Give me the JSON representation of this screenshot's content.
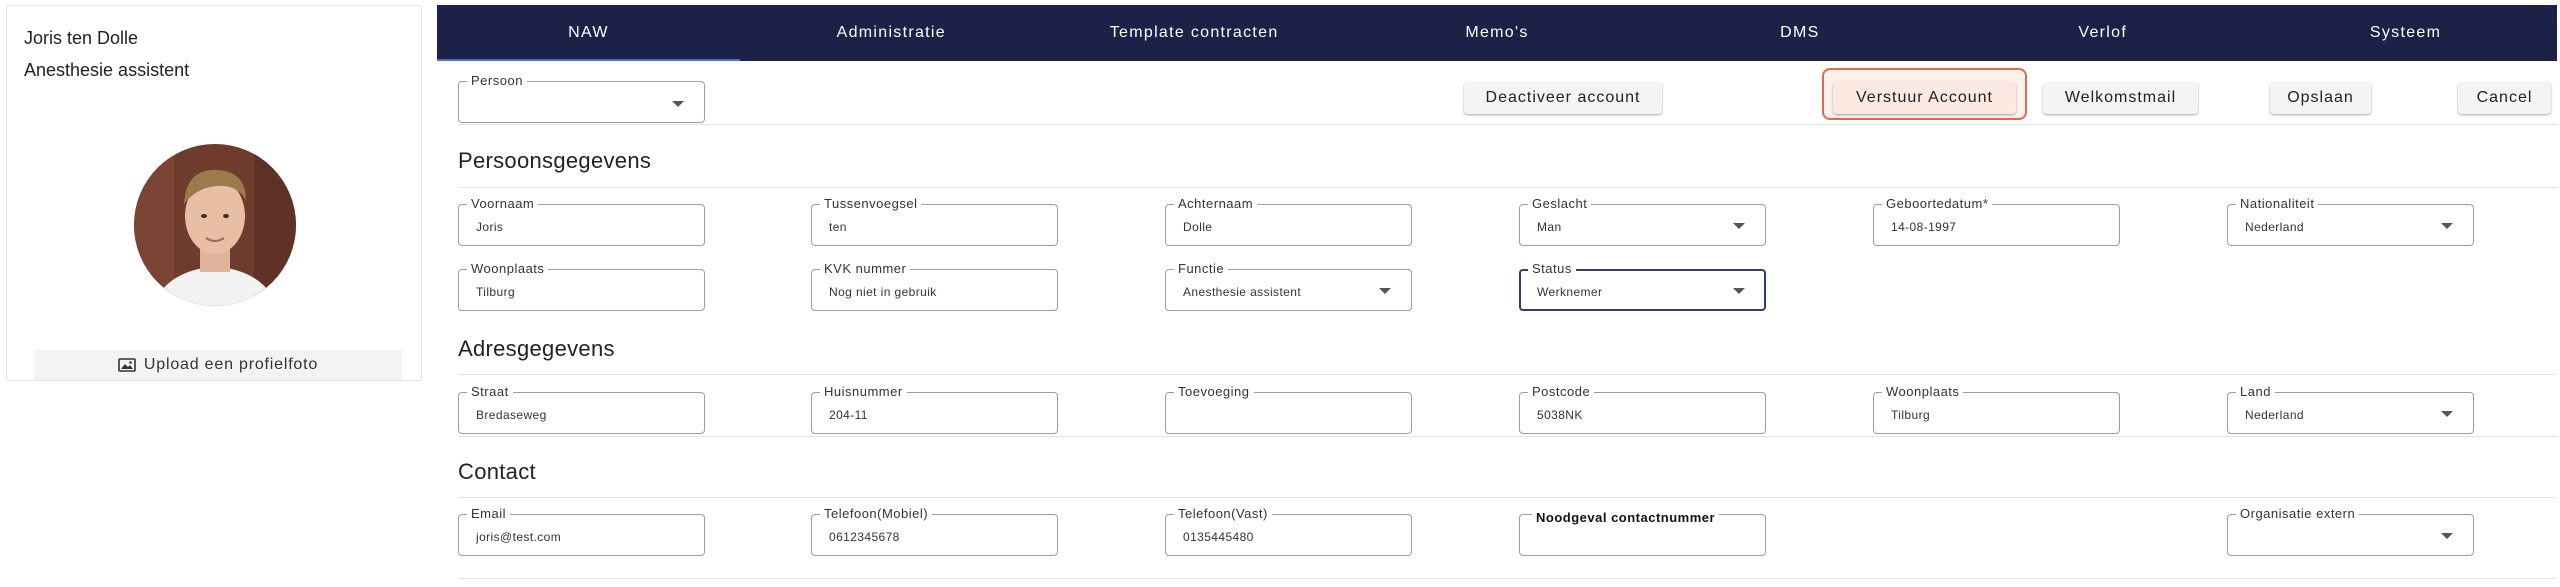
{
  "profile": {
    "name": "Joris ten Dolle",
    "role": "Anesthesie assistent",
    "upload_label": "Upload een profielfoto"
  },
  "tabs": [
    {
      "label": "NAW",
      "active": true
    },
    {
      "label": "Administratie"
    },
    {
      "label": "Template contracten"
    },
    {
      "label": "Memo's"
    },
    {
      "label": "DMS"
    },
    {
      "label": "Verlof"
    },
    {
      "label": "Systeem"
    }
  ],
  "toolbar": {
    "persoon_label": "Persoon",
    "persoon_value": "",
    "deactivate_label": "Deactiveer account",
    "send_account_label": "Verstuur Account",
    "welcome_mail_label": "Welkomstmail",
    "save_label": "Opslaan",
    "cancel_label": "Cancel"
  },
  "sections": {
    "personal": {
      "title": "Persoonsgegevens",
      "voornaam": {
        "label": "Voornaam",
        "value": "Joris"
      },
      "tussenvoegsel": {
        "label": "Tussenvoegsel",
        "value": "ten"
      },
      "achternaam": {
        "label": "Achternaam",
        "value": "Dolle"
      },
      "geslacht": {
        "label": "Geslacht",
        "value": "Man"
      },
      "geboortedatum": {
        "label": "Geboortedatum*",
        "value": "14-08-1997"
      },
      "nationaliteit": {
        "label": "Nationaliteit",
        "value": "Nederland"
      },
      "woonplaats": {
        "label": "Woonplaats",
        "value": "Tilburg"
      },
      "kvk": {
        "label": "KVK nummer",
        "value": "Nog niet in gebruik"
      },
      "functie": {
        "label": "Functie",
        "value": "Anesthesie assistent"
      },
      "status": {
        "label": "Status",
        "value": "Werknemer"
      }
    },
    "address": {
      "title": "Adresgegevens",
      "straat": {
        "label": "Straat",
        "value": "Bredaseweg"
      },
      "huisnummer": {
        "label": "Huisnummer",
        "value": "204-11"
      },
      "toevoeging": {
        "label": "Toevoeging",
        "value": ""
      },
      "postcode": {
        "label": "Postcode",
        "value": "5038NK"
      },
      "woonplaats": {
        "label": "Woonplaats",
        "value": "Tilburg"
      },
      "land": {
        "label": "Land",
        "value": "Nederland"
      }
    },
    "contact": {
      "title": "Contact",
      "email": {
        "label": "Email",
        "value": "joris@test.com"
      },
      "mobiel": {
        "label": "Telefoon(Mobiel)",
        "value": "0612345678"
      },
      "vast": {
        "label": "Telefoon(Vast)",
        "value": "0135445480"
      },
      "noodgeval": {
        "label": "Noodgeval contactnummer",
        "value": ""
      },
      "organisatie": {
        "label": "Organisatie extern",
        "value": ""
      }
    }
  },
  "colors": {
    "tabs_bg": "#1c2147",
    "active_tab_underline": "#4f6bd6",
    "highlight_ring": "#df6a4e",
    "focused_field_border": "#2f3b7a"
  },
  "icons": {
    "upload": "image-icon",
    "dropdown": "caret-down-icon"
  }
}
